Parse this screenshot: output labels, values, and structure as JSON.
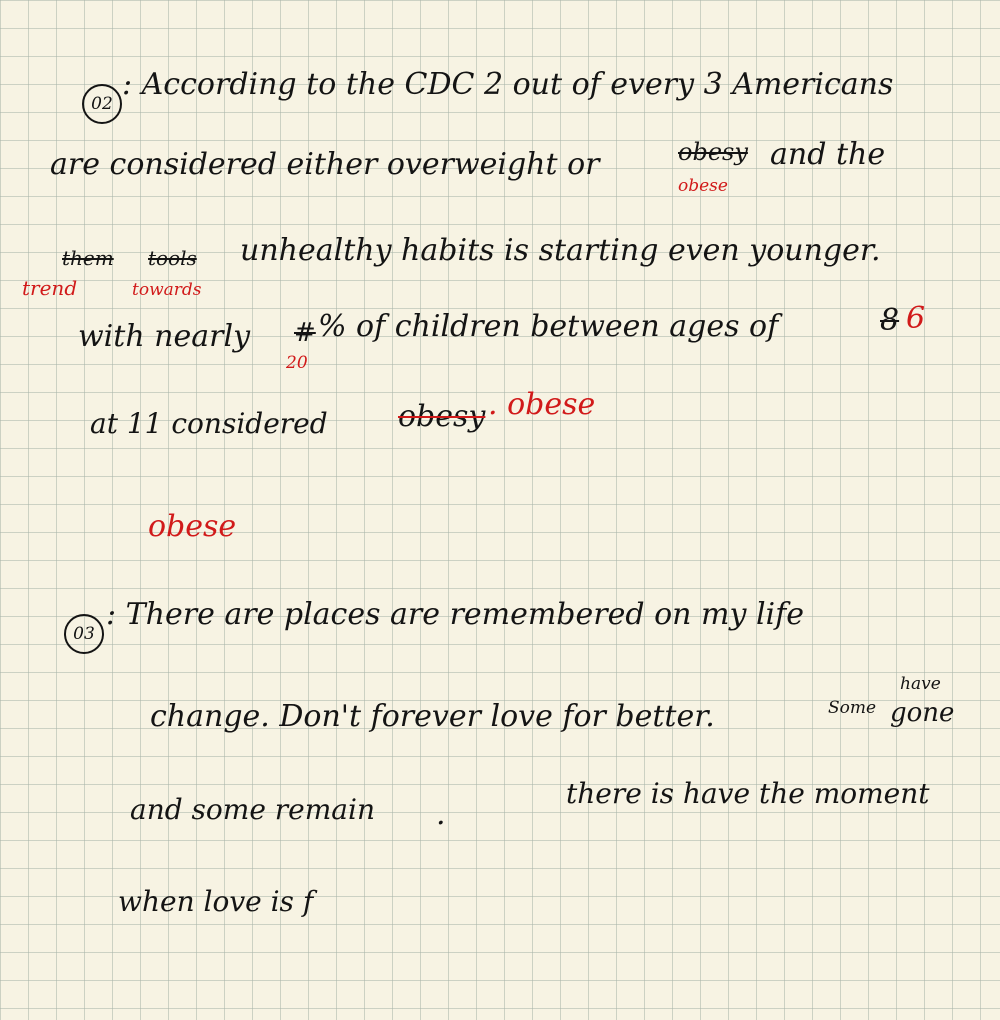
{
  "q2": {
    "number": "02",
    "line1": ": According to the CDC 2 out of every 3 Americans",
    "line2_a": "are considered either overweight or",
    "line2_strike": "obesy",
    "line2_b": "and the",
    "line2_correction": "obese",
    "line3_strike1": "them",
    "line3_strike2": "tools",
    "line3_a": "unhealthy habits is starting even younger.",
    "line3_correction1": "trend",
    "line3_correction2": "towards",
    "line4_a": "with nearly",
    "line4_strike": "#",
    "line4_b": "% of children between ages of",
    "line4_strike2": "8",
    "line4_c": "6",
    "line4_correction": "20",
    "line5_a": "at 11 considered",
    "line5_strike": "obesy",
    "line5_correction": ". obese",
    "extra_word": "obese"
  },
  "q3": {
    "number": "03",
    "line1": ": There are  places are remembered  on my life",
    "line2": "change.  Don't  forever  love  for  better.",
    "line2_small": "Some",
    "line2_super": "have",
    "line2_end": "gone",
    "line3_a": "and some remain",
    "line3_dot": ".",
    "line3_b": "there is  have  the moment",
    "line4": "when love is  f"
  }
}
